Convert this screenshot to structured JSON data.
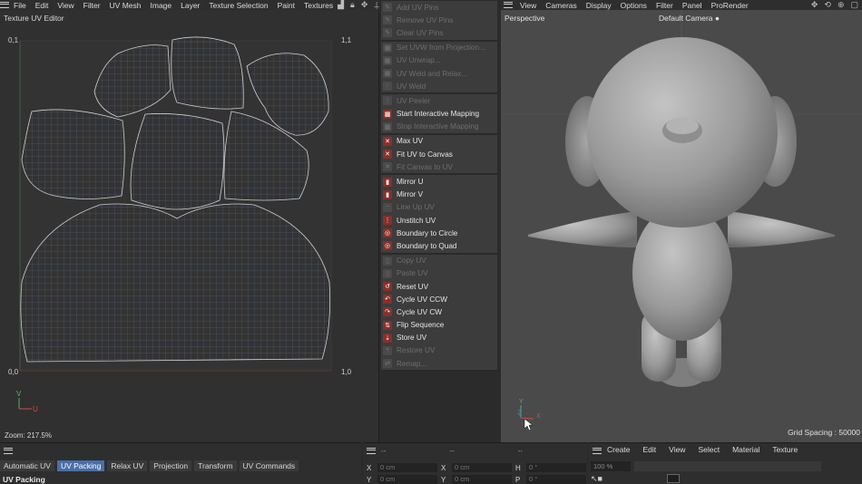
{
  "menubar_left": [
    "File",
    "Edit",
    "View",
    "Filter",
    "UV Mesh",
    "Image",
    "Layer",
    "Texture Selection",
    "Paint",
    "Textures"
  ],
  "menubar_right": [
    "View",
    "Cameras",
    "Display",
    "Options",
    "Filter",
    "Panel",
    "ProRender"
  ],
  "uv_editor": {
    "title": "Texture UV Editor",
    "corner_tl": "0,1",
    "corner_tr": "1,1",
    "corner_bl": "0,0",
    "corner_br": "1,0",
    "zoom": "Zoom: 217.5%",
    "axis_v": "V",
    "axis_u": "U"
  },
  "context_menu": [
    [
      {
        "label": "Add UV Pins",
        "enabled": false
      },
      {
        "label": "Remove UV Pins",
        "enabled": false
      },
      {
        "label": "Clear UV Pins",
        "enabled": false
      }
    ],
    [
      {
        "label": "Set UVW from Projection...",
        "enabled": false
      },
      {
        "label": "UV Unwrap...",
        "enabled": false
      },
      {
        "label": "UV Weld and Relax...",
        "enabled": false
      },
      {
        "label": "UV Weld",
        "enabled": false
      }
    ],
    [
      {
        "label": "UV Peeler",
        "enabled": false
      },
      {
        "label": "Start Interactive Mapping",
        "enabled": true
      },
      {
        "label": "Stop Interactive Mapping",
        "enabled": false
      }
    ],
    [
      {
        "label": "Max UV",
        "enabled": true
      },
      {
        "label": "Fit UV to Canvas",
        "enabled": true
      },
      {
        "label": "Fit Canvas to UV",
        "enabled": false
      }
    ],
    [
      {
        "label": "Mirror U",
        "enabled": true
      },
      {
        "label": "Mirror V",
        "enabled": true
      },
      {
        "label": "Line Up UV",
        "enabled": false
      },
      {
        "label": "Unstitch UV",
        "enabled": true
      },
      {
        "label": "Boundary to Circle",
        "enabled": true
      },
      {
        "label": "Boundary to Quad",
        "enabled": true
      }
    ],
    [
      {
        "label": "Copy UV",
        "enabled": false
      },
      {
        "label": "Paste UV",
        "enabled": false
      },
      {
        "label": "Reset UV",
        "enabled": true
      },
      {
        "label": "Cycle UV CCW",
        "enabled": true
      },
      {
        "label": "Cycle UV CW",
        "enabled": true
      },
      {
        "label": "Flip Sequence",
        "enabled": true
      },
      {
        "label": "Store UV",
        "enabled": true
      },
      {
        "label": "Restore UV",
        "enabled": false
      },
      {
        "label": "Remap...",
        "enabled": false
      }
    ]
  ],
  "viewport": {
    "label": "Perspective",
    "camera": "Default Camera",
    "grid_spacing": "Grid Spacing : 50000",
    "axis_y": "Y",
    "axis_x": "X",
    "axis_z": "Z"
  },
  "bottom_left": {
    "tabs": [
      "Automatic UV",
      "UV Packing",
      "Relax UV",
      "Projection",
      "Transform",
      "UV Commands"
    ],
    "active_tab": "UV Packing",
    "section": "UV Packing"
  },
  "bottom_mid": {
    "dashes": [
      "--",
      "--",
      "--"
    ],
    "rows": [
      {
        "l1": "X",
        "v1": "0 cm",
        "l2": "X",
        "v2": "0 cm",
        "l3": "H",
        "v3": "0 °"
      },
      {
        "l1": "Y",
        "v1": "0 cm",
        "l2": "Y",
        "v2": "0 cm",
        "l3": "P",
        "v3": "0 °"
      }
    ]
  },
  "bottom_right": {
    "menus": [
      "Create",
      "Edit",
      "View",
      "Select",
      "Material",
      "Texture"
    ],
    "zoom": "100 %"
  },
  "colors": {
    "accent": "#4a6fa8",
    "icon_red": "#8a2f2a",
    "uv_line": "#d0d0d0",
    "uv_grid": "#5a6a8a"
  }
}
